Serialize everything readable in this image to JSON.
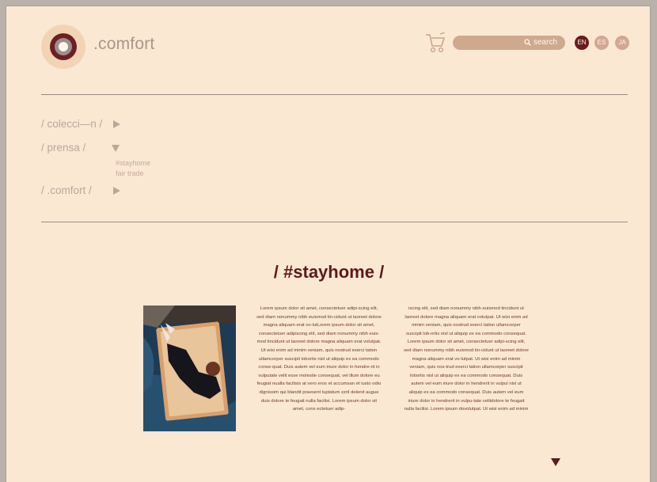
{
  "header": {
    "brand": ".comfort",
    "search_label": "search",
    "languages": [
      "EN",
      "ES",
      "JA"
    ],
    "active_language": "EN"
  },
  "nav": {
    "items": [
      {
        "label": "/ colecci—n /"
      },
      {
        "label": "/ prensa /",
        "sub": [
          "#stayhome",
          "fair trade"
        ]
      },
      {
        "label": "/ .comfort /"
      }
    ]
  },
  "article": {
    "title": "/ #stayhome /",
    "col1": "Lorem ipsum dolor sit amet, consectetuer adipi-scing elit, sed diam nonummy nibh euismod tin-cidunt ut laoreet dolore magna aliquam erat vo-lutLorem ipsum dolor sit amet, consectetuer adipiscing elit, sed diam nonummy nibh euis-mod tincidunt ut laoreet dolore magna aliquam erat volutpat. Ut wisi enim ad minim veniam, quis nostrud exerci tation ullamcorper suscipit lobortis nisl ut aliquip ex ea commodo conse-quat. Duis autem vel eum iriure dolor in hendre-rit in vulputate velit esse molestie consequat, vel illum dolore eu feugiat nualla facilisis at vero eros et accumsan et iusto odio dignissim qui blandit praesent luptatum zzril delenit augue duis dolore te feugait nulla facilisi. Lorem ipsum dolor sit amet, cons ectetuer adip-",
    "col2": "iscing elit, sed diam nonummy nibh euismod tincidunt ut laoreet dolore magna aliquam erat volutpat. Ut wisi enim ad minim veniam, quis nostrud exerci tation ullamcorper suscipit lob-ortis nisl ut aliquip ex ea commodo consequat. Lorem ipsum dolor sit amet, consectetuer adipi-scing elit, sed diam nonummy nibh euismod tin-cidunt ut laoreet dolore magna aliquam erat vo-lutpat. Ut wisi enim ad minim veniam, quis nos-trud exerci tation ullamcorper suscipit lobortis nisl ut aliquip ex ea commodo consequat. Duis autem vel eum iriure dolor in hendrerit in vulpul nisl ut aliquip ex ea commodo consequat. Duis autem vel eum iriure dolor in hendrerit in vulpu-tate velitdolore te feugait nulla facilisi. Lorem ipsum dovolutpat. Ut wisi enim ad minim"
  },
  "colors": {
    "background": "#fbe8d3",
    "accent": "#5e1a1d",
    "muted": "#b9a79a",
    "search_bg": "#cfa98e"
  }
}
